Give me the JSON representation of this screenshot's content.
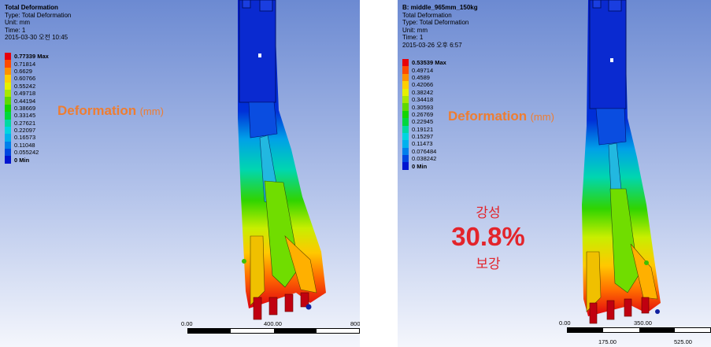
{
  "left": {
    "header": [
      "Total Deformation",
      "Type: Total Deformation",
      "Unit: mm",
      "Time: 1",
      "2015-03-30 오전 10:45"
    ],
    "legend": [
      {
        "label": "0.77339 Max",
        "color": "#e8000b"
      },
      {
        "label": "0.71814",
        "color": "#ff4a00"
      },
      {
        "label": "0.6629",
        "color": "#ff9100"
      },
      {
        "label": "0.60766",
        "color": "#ffcf00"
      },
      {
        "label": "0.55242",
        "color": "#e6f000"
      },
      {
        "label": "0.49718",
        "color": "#a8e800"
      },
      {
        "label": "0.44194",
        "color": "#5fd800"
      },
      {
        "label": "0.38669",
        "color": "#14d400"
      },
      {
        "label": "0.33145",
        "color": "#00d73e"
      },
      {
        "label": "0.27621",
        "color": "#00d9a3"
      },
      {
        "label": "0.22097",
        "color": "#00d5e0"
      },
      {
        "label": "0.16573",
        "color": "#00b1ee"
      },
      {
        "label": "0.11048",
        "color": "#0080ec"
      },
      {
        "label": "0.055242",
        "color": "#0047e1"
      },
      {
        "label": "0 Min",
        "color": "#0015d0"
      }
    ],
    "deformation_title": "Deformation",
    "deformation_unit": "(mm)",
    "scale": {
      "ticks": [
        "0.00",
        "400.00",
        "800"
      ]
    }
  },
  "right": {
    "header": [
      "B: middle_965mm_150kg",
      "Total Deformation",
      "Type: Total Deformation",
      "Unit: mm",
      "Time: 1",
      "2015-03-26 오후 6:57"
    ],
    "legend": [
      {
        "label": "0.53539 Max",
        "color": "#e8000b"
      },
      {
        "label": "0.49714",
        "color": "#ff4a00"
      },
      {
        "label": "0.4589",
        "color": "#ff9100"
      },
      {
        "label": "0.42066",
        "color": "#ffcf00"
      },
      {
        "label": "0.38242",
        "color": "#e6f000"
      },
      {
        "label": "0.34418",
        "color": "#a8e800"
      },
      {
        "label": "0.30593",
        "color": "#5fd800"
      },
      {
        "label": "0.26769",
        "color": "#14d400"
      },
      {
        "label": "0.22945",
        "color": "#00d73e"
      },
      {
        "label": "0.19121",
        "color": "#00d9a3"
      },
      {
        "label": "0.15297",
        "color": "#00d5e0"
      },
      {
        "label": "0.11473",
        "color": "#00b1ee"
      },
      {
        "label": "0.076484",
        "color": "#0080ec"
      },
      {
        "label": "0.038242",
        "color": "#0047e1"
      },
      {
        "label": "0 Min",
        "color": "#0015d0"
      }
    ],
    "deformation_title": "Deformation",
    "deformation_unit": "(mm)",
    "annotation": {
      "line1": "강성",
      "value": "30.8%",
      "line2": "보강"
    },
    "scale": {
      "ticks_top": [
        "0.00",
        "350.00"
      ],
      "ticks_bottom": [
        "175.00",
        "525.00"
      ]
    }
  }
}
